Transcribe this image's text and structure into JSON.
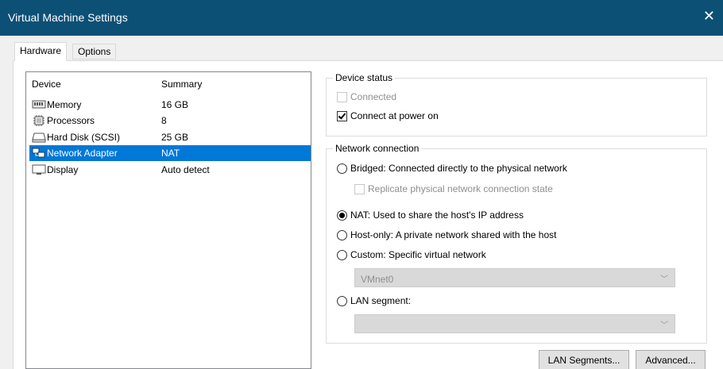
{
  "window": {
    "title": "Virtual Machine Settings",
    "close_glyph": "✕"
  },
  "tabs": [
    {
      "label": "Hardware"
    },
    {
      "label": "Options"
    }
  ],
  "device_list": {
    "headers": {
      "device": "Device",
      "summary": "Summary"
    },
    "rows": [
      {
        "name": "Memory",
        "summary": "16 GB",
        "icon": "memory-icon"
      },
      {
        "name": "Processors",
        "summary": "8",
        "icon": "processor-icon"
      },
      {
        "name": "Hard Disk (SCSI)",
        "summary": "25 GB",
        "icon": "hard-disk-icon"
      },
      {
        "name": "Network Adapter",
        "summary": "NAT",
        "icon": "network-adapter-icon",
        "selected": true
      },
      {
        "name": "Display",
        "summary": "Auto detect",
        "icon": "display-icon"
      }
    ]
  },
  "device_status": {
    "legend": "Device status",
    "connected": {
      "label": "Connected",
      "checked": false,
      "enabled": false
    },
    "connect_at_power_on": {
      "label": "Connect at power on",
      "checked": true,
      "enabled": true
    }
  },
  "network_connection": {
    "legend": "Network connection",
    "bridged": {
      "label": "Bridged: Connected directly to the physical network",
      "selected": false
    },
    "replicate": {
      "label": "Replicate physical network connection state",
      "checked": false,
      "enabled": false
    },
    "nat": {
      "label": "NAT: Used to share the host's IP address",
      "selected": true
    },
    "host_only": {
      "label": "Host-only: A private network shared with the host",
      "selected": false
    },
    "custom": {
      "label": "Custom: Specific virtual network",
      "selected": false
    },
    "custom_select": {
      "value": "VMnet0",
      "enabled": false
    },
    "lan_segment": {
      "label": "LAN segment:",
      "selected": false
    },
    "lan_select": {
      "value": "",
      "enabled": false
    }
  },
  "buttons": {
    "lan_segments": "LAN Segments...",
    "advanced": "Advanced..."
  },
  "colors": {
    "titlebar": "#0c5076",
    "selection": "#0078d7"
  }
}
